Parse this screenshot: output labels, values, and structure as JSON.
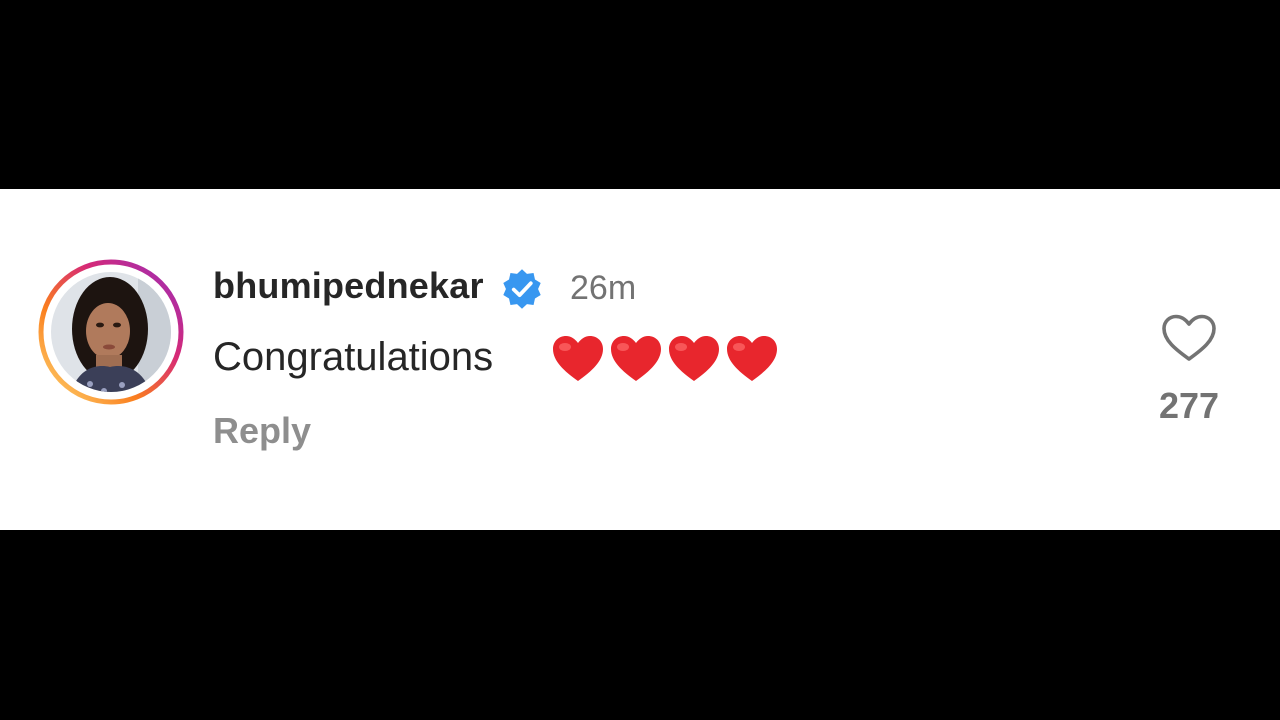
{
  "comment": {
    "username": "bhumipednekar",
    "verified_icon": "verified-badge-icon",
    "timestamp": "26m",
    "text": "Congratulations",
    "emoji": [
      "❤️",
      "❤️",
      "❤️",
      "❤️"
    ],
    "reply_label": "Reply",
    "like_count": "277",
    "like_icon": "heart-outline-icon"
  },
  "colors": {
    "username": "#262626",
    "meta": "#737373",
    "verified": "#3897f0",
    "heart": "#e8262d",
    "story_ring_start": "#f9a825",
    "story_ring_end": "#c13584",
    "background": "#ffffff",
    "letterbox": "#000000"
  }
}
